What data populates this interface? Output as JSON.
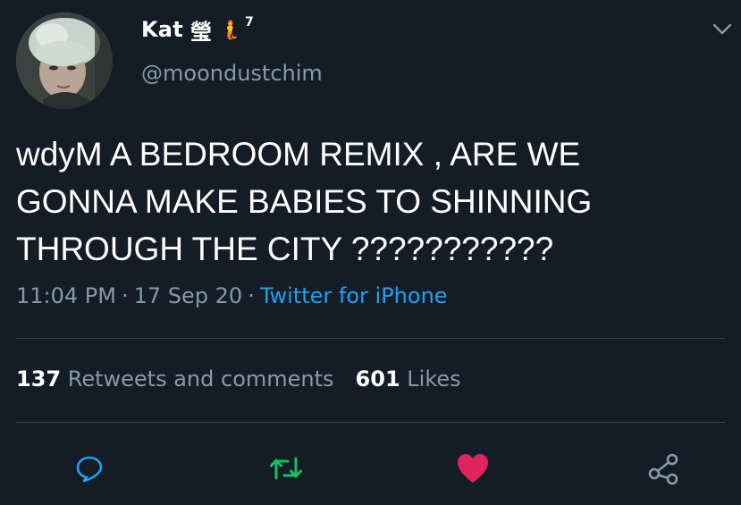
{
  "user": {
    "display_name": "Kat",
    "name_glyph": "瑩",
    "name_emoji": "🧜",
    "name_superscript": "7",
    "handle": "@moondustchim",
    "avatar": "avatar-photo"
  },
  "tweet": {
    "text": "wdyM A BEDROOM REMIX , ARE WE\nGONNA MAKE BABIES TO SHINNING\nTHROUGH THE CITY ???????????",
    "time": "11:04 PM",
    "separator": "·",
    "date": "17 Sep 20",
    "source": "Twitter for iPhone"
  },
  "stats": {
    "retweets_count": "137",
    "retweets_label": "Retweets and comments",
    "likes_count": "601",
    "likes_label": "Likes"
  },
  "icons": {
    "menu": "chevron-down-icon",
    "reply": "reply-icon",
    "retweet": "retweet-icon",
    "like": "heart-icon",
    "share": "share-icon"
  },
  "colors": {
    "background": "#141d26",
    "secondary_text": "#8899a6",
    "link": "#1da1f2",
    "retweet": "#17bf63",
    "like": "#e0245e",
    "divider": "#38444d"
  }
}
